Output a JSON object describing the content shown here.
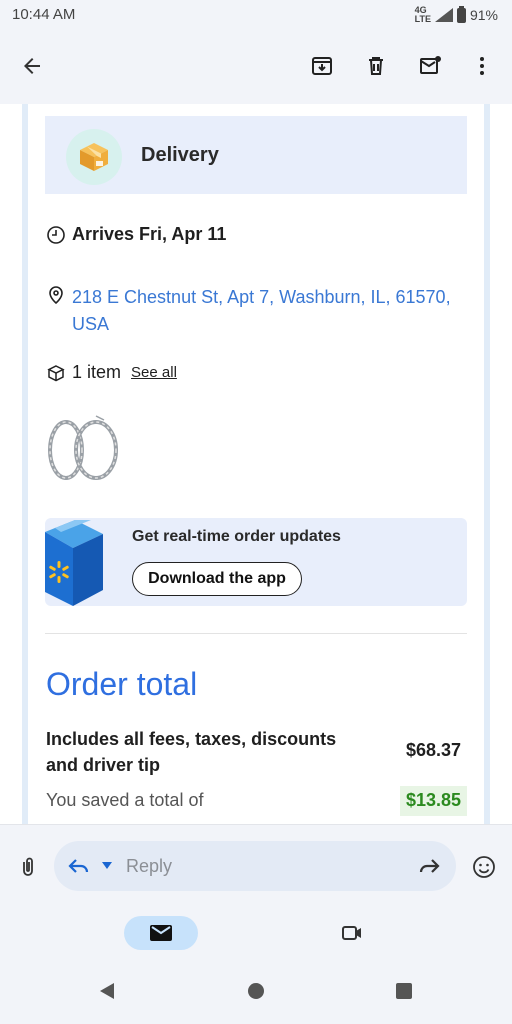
{
  "status": {
    "time": "10:44 AM",
    "network": "4G LTE",
    "battery": "91%"
  },
  "delivery": {
    "title": "Delivery",
    "arrives": "Arrives Fri, Apr 11",
    "address": "218 E Chestnut St, Apt 7, Washburn, IL, 61570, USA",
    "items_count": "1 item",
    "see_all": "See all"
  },
  "promo": {
    "text": "Get real-time order updates",
    "button": "Download the app"
  },
  "order": {
    "heading": "Order total",
    "includes": "Includes all fees, taxes, discounts and driver tip",
    "total": "$68.37",
    "saved_label": "You saved a total of",
    "saved_amount": "$13.85"
  },
  "reply": {
    "placeholder": "Reply"
  },
  "colors": {
    "accent_blue": "#2f6fe0",
    "link_blue": "#3a78d4",
    "savings_green": "#2b8a1f",
    "card_bg": "#e8eefb"
  }
}
